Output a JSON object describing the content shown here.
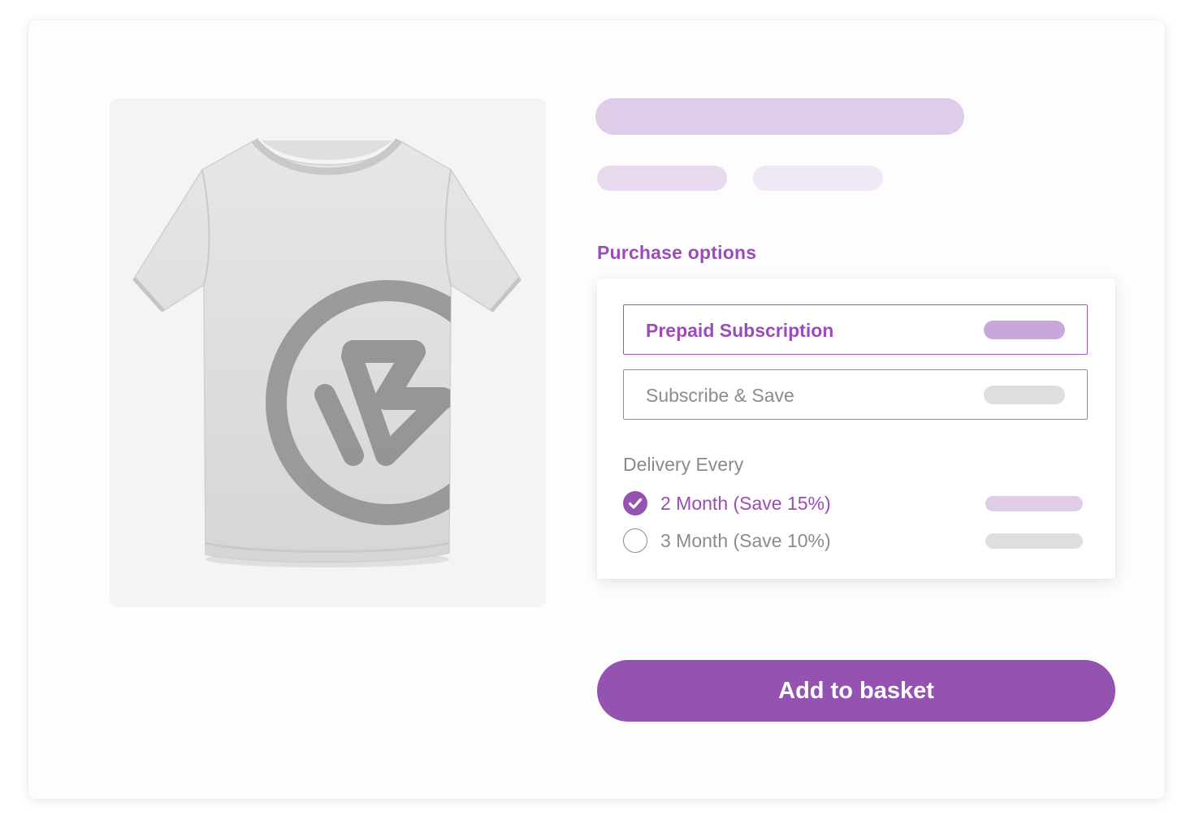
{
  "colors": {
    "accent": "#9452b1",
    "accent_text": "#9b4db5",
    "pill_purple_strong": "#c9a7dc",
    "pill_purple_light": "#e0cce8",
    "pill_purple_lighter": "#e9dbef",
    "pill_purple_lightest": "#f1e8f5",
    "pill_gray": "#dedede",
    "muted_text": "#8c8c8c"
  },
  "product": {
    "image_icon": "tshirt-image"
  },
  "purchase": {
    "section_label": "Purchase options",
    "options": [
      {
        "label": "Prepaid Subscription",
        "selected": true
      },
      {
        "label": "Subscribe & Save",
        "selected": false
      }
    ],
    "delivery_label": "Delivery Every",
    "frequencies": [
      {
        "label": "2 Month (Save 15%)",
        "checked": true
      },
      {
        "label": "3 Month (Save 10%)",
        "checked": false
      }
    ]
  },
  "cta": {
    "label": "Add to basket"
  }
}
